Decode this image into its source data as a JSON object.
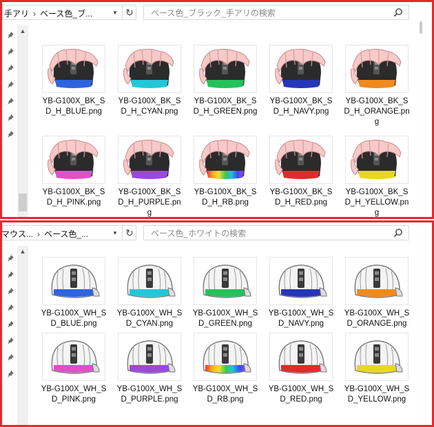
{
  "panes": [
    {
      "address": {
        "parent": "手アリ",
        "current": "ベース色_ブ..."
      },
      "search": {
        "placeholder": "ベース色_ブラック_手アリの検索"
      },
      "files": [
        {
          "name": "YB-G100X_BK_SD_H_BLUE.png",
          "color": "#2f63e0"
        },
        {
          "name": "YB-G100X_BK_SD_H_CYAN.png",
          "color": "#22c7d8"
        },
        {
          "name": "YB-G100X_BK_SD_H_GREEN.png",
          "color": "#23c25a"
        },
        {
          "name": "YB-G100X_BK_SD_H_NAVY.png",
          "color": "#2636b8"
        },
        {
          "name": "YB-G100X_BK_SD_H_ORANGE.png",
          "color": "#f08a1c"
        },
        {
          "name": "YB-G100X_BK_SD_H_PINK.png",
          "color": "#e24fc9"
        },
        {
          "name": "YB-G100X_BK_SD_H_PURPLE.png",
          "color": "#9a48e0"
        },
        {
          "name": "YB-G100X_BK_SD_H_RB.png",
          "color": "rainbow"
        },
        {
          "name": "YB-G100X_BK_SD_H_RED.png",
          "color": "#e22a2a"
        },
        {
          "name": "YB-G100X_BK_SD_H_YELLOW.png",
          "color": "#e8d81e"
        }
      ]
    },
    {
      "address": {
        "parent": "マウス...",
        "current": "ベース色_..."
      },
      "search": {
        "placeholder": "ベース色_ホワイトの検索"
      },
      "files": [
        {
          "name": "YB-G100X_WH_SD_BLUE.png",
          "color": "#2f63e0"
        },
        {
          "name": "YB-G100X_WH_SD_CYAN.png",
          "color": "#22c7d8"
        },
        {
          "name": "YB-G100X_WH_SD_GREEN.png",
          "color": "#23c25a"
        },
        {
          "name": "YB-G100X_WH_SD_NAVY.png",
          "color": "#2636b8"
        },
        {
          "name": "YB-G100X_WH_SD_ORANGE.png",
          "color": "#f08a1c"
        },
        {
          "name": "YB-G100X_WH_SD_PINK.png",
          "color": "#e24fc9"
        },
        {
          "name": "YB-G100X_WH_SD_PURPLE.png",
          "color": "#9a48e0"
        },
        {
          "name": "YB-G100X_WH_SD_RB.png",
          "color": "rainbow"
        },
        {
          "name": "YB-G100X_WH_SD_RED.png",
          "color": "#e22a2a"
        },
        {
          "name": "YB-G100X_WH_SD_YELLOW.png",
          "color": "#e8d81e"
        }
      ]
    }
  ],
  "icons": {
    "refresh": "refresh-icon",
    "search": "search-icon",
    "pin": "pin-icon",
    "dropdown": "chevron-down-icon"
  },
  "colors": {
    "frame": "#e8282e"
  }
}
